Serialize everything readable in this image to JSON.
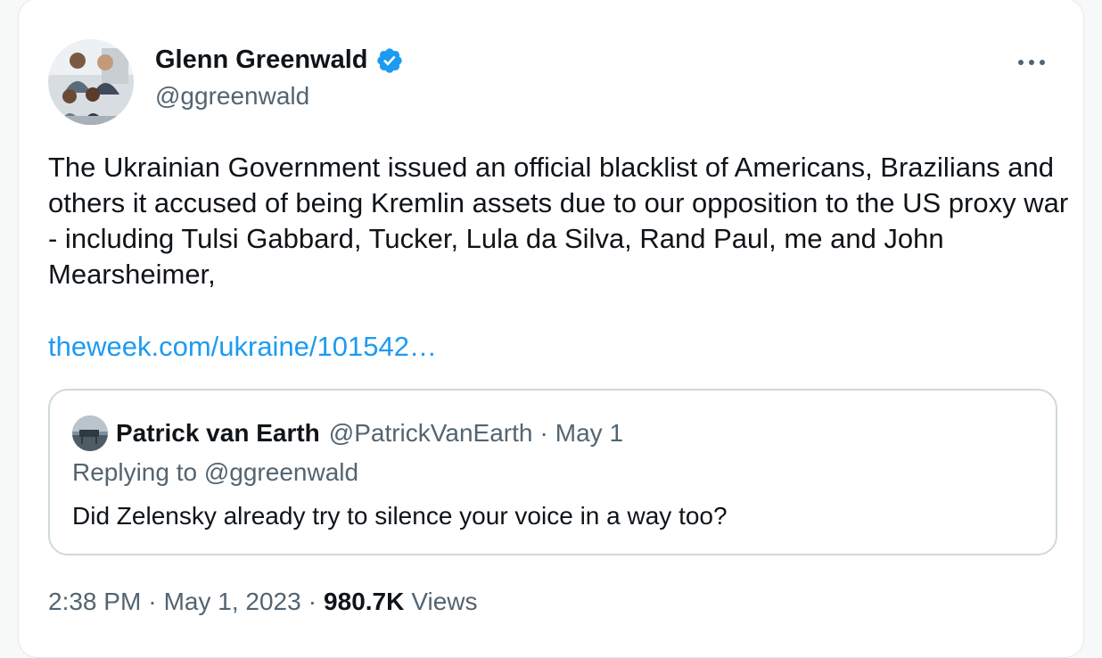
{
  "author": {
    "name": "Glenn Greenwald",
    "handle": "@ggreenwald",
    "verified": true,
    "verified_color": "#1d9bf0"
  },
  "tweet": {
    "text": "The Ukrainian Government issued an official blacklist of Americans, Brazilians and others it accused of being Kremlin assets due to our opposition to the US proxy war - including Tulsi Gabbard, Tucker, Lula da Silva, Rand Paul, me and John Mearsheimer,",
    "link": "theweek.com/ukraine/101542…"
  },
  "quote": {
    "name": "Patrick van Earth",
    "handle": "@PatrickVanEarth",
    "separator": "·",
    "date": "May 1",
    "replying_to": "Replying to @ggreenwald",
    "text": "Did Zelensky already try to silence your voice in a way too?"
  },
  "meta": {
    "time": "2:38 PM",
    "separator": "·",
    "date": "May 1, 2023",
    "views_count": "980.7K",
    "views_label": "Views"
  },
  "icons": {
    "more": "more-horizontal-icon",
    "verified": "verified-badge-icon"
  },
  "colors": {
    "link": "#1d9bf0",
    "secondary_text": "#536471",
    "primary_text": "#0f1419",
    "border": "#cfd9de"
  }
}
